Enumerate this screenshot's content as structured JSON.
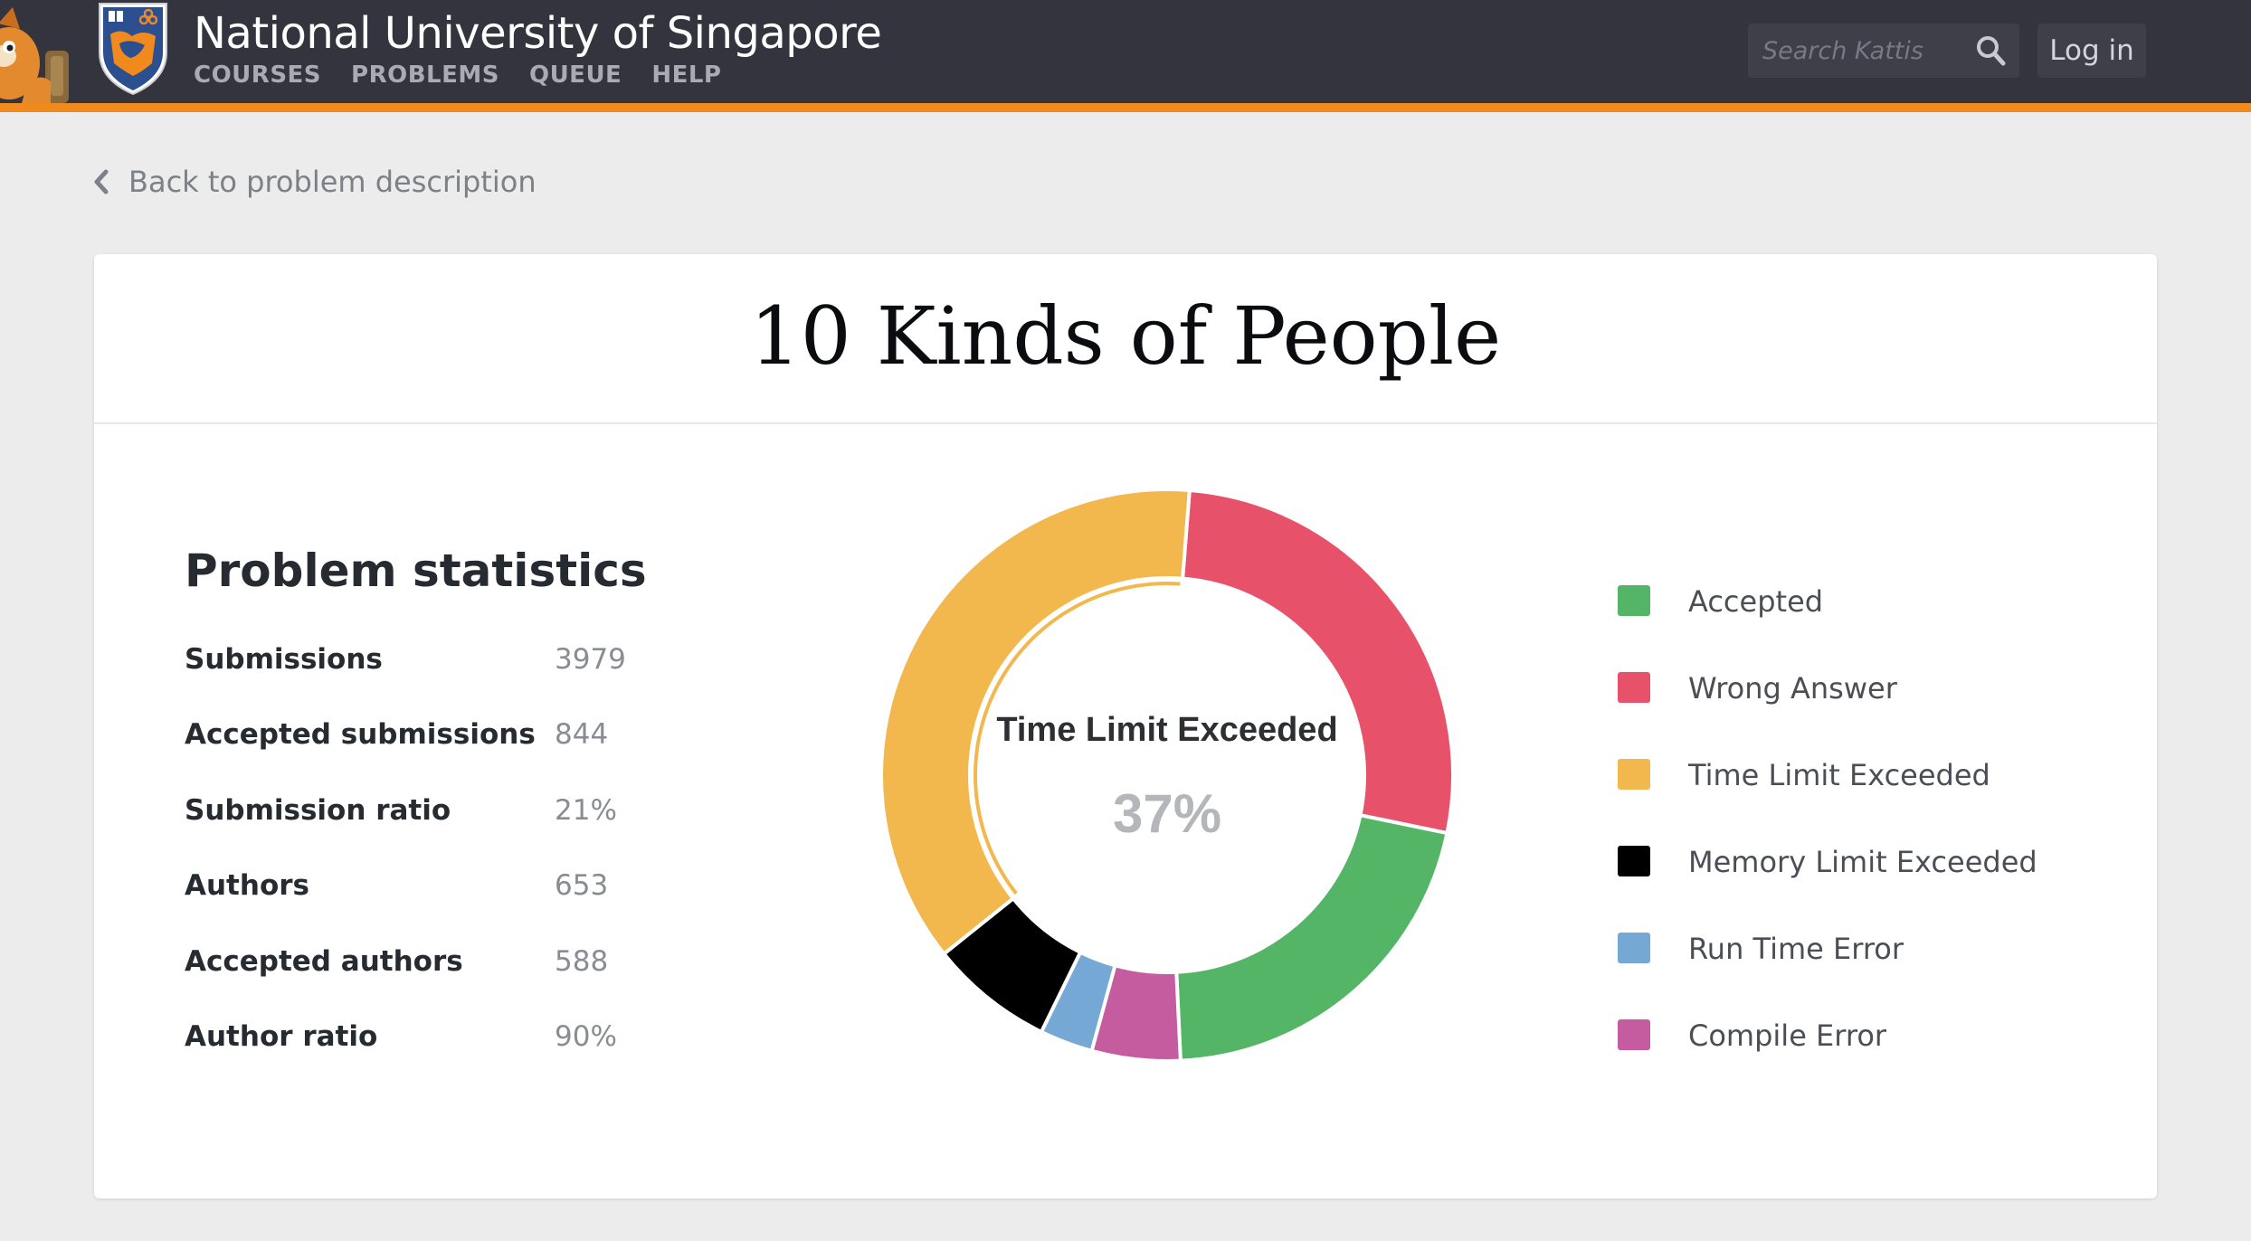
{
  "header": {
    "site_title": "National University of Singapore",
    "nav": [
      "COURSES",
      "PROBLEMS",
      "QUEUE",
      "HELP"
    ],
    "search_placeholder": "Search Kattis",
    "login_label": "Log in"
  },
  "back_link": {
    "label": "Back to problem description"
  },
  "problem": {
    "title": "10 Kinds of People"
  },
  "stats": {
    "heading": "Problem statistics",
    "rows": [
      {
        "label": "Submissions",
        "value": "3979"
      },
      {
        "label": "Accepted submissions",
        "value": "844"
      },
      {
        "label": "Submission ratio",
        "value": "21%"
      },
      {
        "label": "Authors",
        "value": "653"
      },
      {
        "label": "Accepted authors",
        "value": "588"
      },
      {
        "label": "Author ratio",
        "value": "90%"
      }
    ]
  },
  "chart_data": {
    "type": "pie",
    "hole": true,
    "categories": [
      "Accepted",
      "Wrong Answer",
      "Time Limit Exceeded",
      "Memory Limit Exceeded",
      "Run Time Error",
      "Compile Error"
    ],
    "values": [
      21,
      27,
      37,
      7,
      3,
      5
    ],
    "colors": [
      "#55b567",
      "#e8516a",
      "#f2b84e",
      "#000000",
      "#76a8d6",
      "#c45c9f"
    ],
    "highlighted": "Time Limit Exceeded",
    "center_label": "Time Limit Exceeded",
    "center_value": "37%",
    "legend_position": "right"
  }
}
